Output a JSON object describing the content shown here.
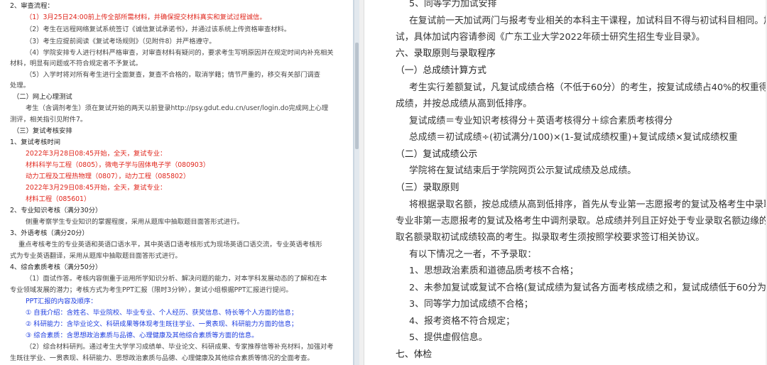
{
  "left": {
    "lines": [
      "2、审查流程：",
      "（1）3月25日24:00前上传全部所需材料，并确保提交材料真实和复试过程诚信。",
      "（2）考生在远程网络复试系统签订《诚信复试承诺书》，并通过该系统上传资格审查材料。",
      "（3）考生应提前阅读《复试考场规则》（见附件8）并严格遵守。",
      "（4）学院安排专人进行材料严格审查，对审查材料有疑问的，要求考生写明原因并在规定时间内补充相关",
      "材料，明显有问题或不符合规定者不予复试。",
      "（5）入学时将对所有考生进行全面复查，复查不合格的，取消学籍；情节严重的，移交有关部门调查",
      "处理。",
      "（二）网上心理测试",
      "考生（含调剂考生）须在复试开始的两天以前登录http://psy.gdut.edu.cn/user/login.do完成网上心理",
      "测评，相关指引见附件7。",
      "（三）复试考核安排",
      "1、复试考核时间",
      "2022年3月28日08:45开始，全天，复试专业：",
      "材料科学与工程（0805），微电子学与固体电子学（080903）",
      "动力工程及工程热物理（0807），动力工程（085802）",
      "2022年3月29日08:45开始，全天，复试专业：",
      "材料工程（085601）",
      "2、专业知识考核（满分30分）",
      "侧重考察学生专业知识的掌握程度，采用从题库中抽取题目面答形式进行。",
      "3、外语考核（满分20分）",
      "重点考核考生的专业英语和英语口语水平，其中英语口语考核形式为现场英语口语交流，专业英语考核形",
      "式为专业英语翻译，采用从题库中抽取题目面答形式进行。",
      "4、综合素质考核（满分50分）",
      "（1）面试作答。考核内容侧重于运用所学知识分析、解决问题的能力，对本学科发展动态的了解和在本",
      "专业领域发展的潜力；考核方式为考生PPT汇报（限时3分钟），复试小组根据PPT汇报进行提问。",
      "PPT汇报的内容及顺序：",
      "① 自我介绍：含姓名、毕业院校、毕业专业、个人经历、获奖信息、特长等个人方面的信息；",
      "② 科研能力：含毕业论文、科研成果等体现考生既往学业、一贯表现、科研能力方面的信息；",
      "③ 综合素质：含思想政治素质与品德、心理健康及其他综合素质等方面的信息。",
      "（2）综合材料研判。通过考生大学学习成绩单、毕业论文、科研成果、专家推荐信等补充材料，加强对考",
      "生既往学业、一贯表现、科研能力、思想政治素质与品德、心理健康及其他综合素质等情况的全面考查。"
    ]
  },
  "right": {
    "lines": [
      "5、同等学力加试安排",
      "在复试前一天加试两门与报考专业相关的本科主干课程，加试科目不得与初试科目相同。加试方式为笔",
      "试，具体加试内容请参阅《广东工业大学2022年硕士研究生招生专业目录》。",
      "六、录取原则与录取程序",
      "（一）总成绩计算方式",
      "考生实行差额复试，凡复试成绩合格（不低于60分）的考生，按复试成绩占40%的权重得出招生考试总",
      "成绩，并按总成绩从高到低排序。",
      "复试成绩＝专业知识考核得分＋英语考核得分＋综合素质考核得分",
      "总成绩＝初试成绩÷(初试满分/100)×(1-复试成绩权重)+复试成绩×复试成绩权重",
      "（二）复试成绩公示",
      "学院将在复试结束后于学院网页公示复试成绩及总成绩。",
      "（三）录取原则",
      "将根据录取名额，按总成绩从高到低排序，首先从专业第一志愿报考的复试及格考生中录取，其次再从",
      "专业非第一志愿报考的复试及格考生中调剂录取。总成绩并列且正好处于专业录取名额边缘的考生，按照录",
      "取名额录取初试成绩较高的考生。拟录取考生须按照学校要求签订相关协议。",
      "有以下情况之一者，不予录取：",
      "1、思想政治素质和道德品质考核不合格；",
      "2、未参加复试或复试不合格(复试成绩为复试各方面考核成绩之和，复试成绩低于60分为不合格)；",
      "3、同等学力加试成绩不合格；",
      "4、报考资格不符合规定；",
      "5、提供虚假信息。",
      "七、体检"
    ]
  }
}
